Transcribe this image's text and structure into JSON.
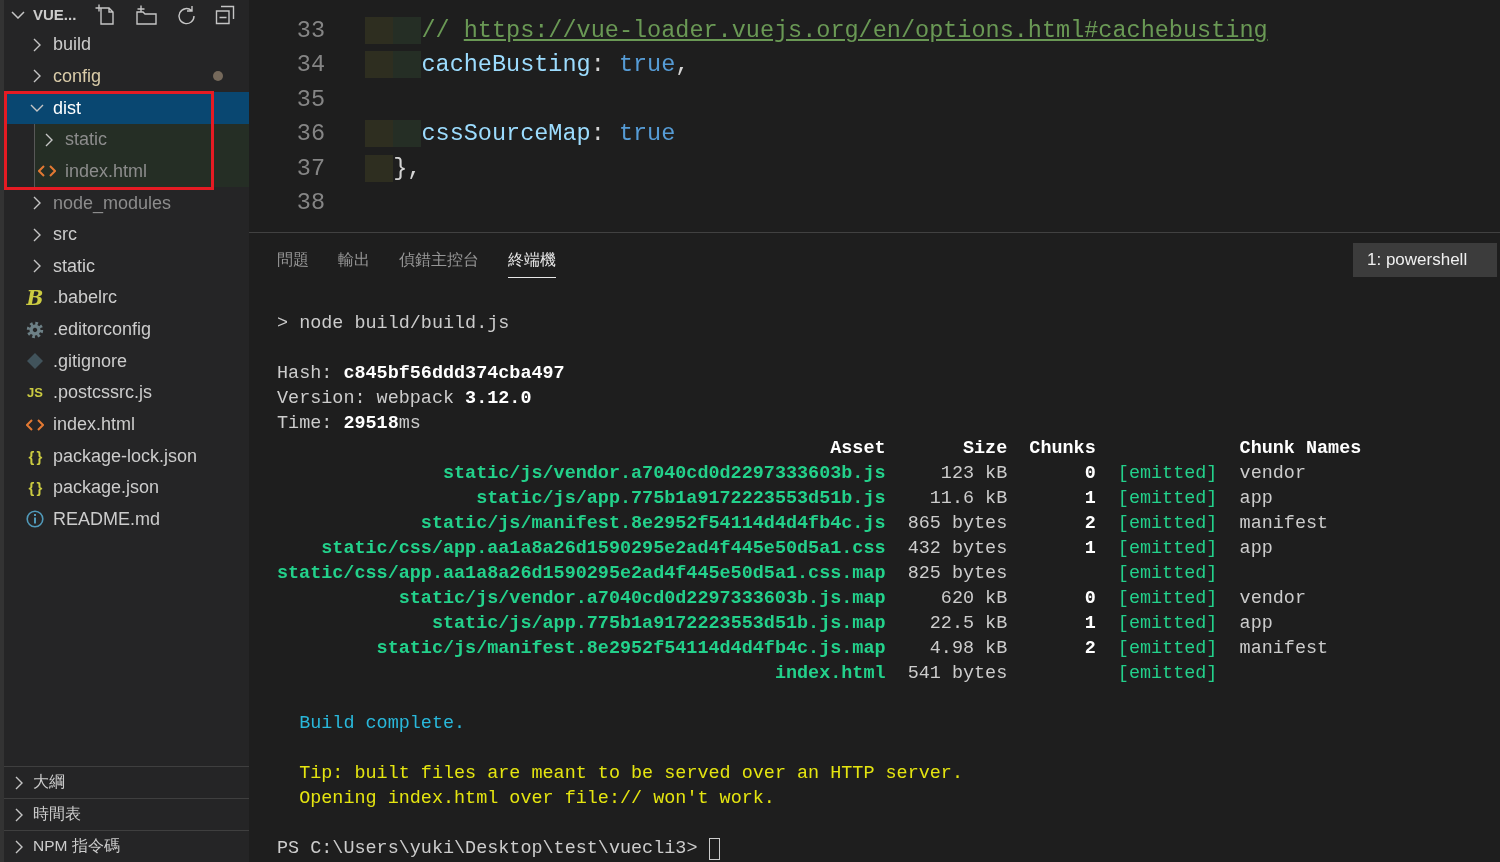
{
  "explorer": {
    "title": "VUE...",
    "tree": [
      {
        "label": "build",
        "kind": "folder",
        "expanded": false,
        "selected": false,
        "dimmed": false,
        "modified": false,
        "highlighted": false
      },
      {
        "label": "config",
        "kind": "folder",
        "expanded": false,
        "selected": false,
        "dimmed": false,
        "modified": true,
        "highlighted": false
      },
      {
        "label": "dist",
        "kind": "folder",
        "expanded": true,
        "selected": true,
        "dimmed": false,
        "modified": false,
        "highlighted": true,
        "children": [
          {
            "label": "static",
            "kind": "folder",
            "expanded": false,
            "selected": false,
            "dimmed": true,
            "modified": false,
            "highlighted": false
          },
          {
            "label": "index.html",
            "kind": "html",
            "selected": false,
            "dimmed": true,
            "modified": false,
            "highlighted": false
          }
        ]
      },
      {
        "label": "node_modules",
        "kind": "folder",
        "expanded": false,
        "selected": false,
        "dimmed": true,
        "modified": false,
        "highlighted": false
      },
      {
        "label": "src",
        "kind": "folder",
        "expanded": false,
        "selected": false,
        "dimmed": false,
        "modified": false,
        "highlighted": false
      },
      {
        "label": "static",
        "kind": "folder",
        "expanded": false,
        "selected": false,
        "dimmed": false,
        "modified": false,
        "highlighted": false
      },
      {
        "label": ".babelrc",
        "kind": "babel",
        "glyph": "B",
        "selected": false,
        "dimmed": false,
        "modified": false,
        "highlighted": false
      },
      {
        "label": ".editorconfig",
        "kind": "config",
        "selected": false,
        "dimmed": false,
        "modified": false,
        "highlighted": false
      },
      {
        "label": ".gitignore",
        "kind": "git",
        "selected": false,
        "dimmed": false,
        "modified": false,
        "highlighted": false
      },
      {
        "label": ".postcssrc.js",
        "kind": "js",
        "glyph": "JS",
        "selected": false,
        "dimmed": false,
        "modified": false,
        "highlighted": false
      },
      {
        "label": "index.html",
        "kind": "html",
        "selected": false,
        "dimmed": false,
        "modified": false,
        "highlighted": false
      },
      {
        "label": "package-lock.json",
        "kind": "json",
        "glyph": "{ }",
        "selected": false,
        "dimmed": false,
        "modified": false,
        "highlighted": false
      },
      {
        "label": "package.json",
        "kind": "json",
        "glyph": "{ }",
        "selected": false,
        "dimmed": false,
        "modified": false,
        "highlighted": false
      },
      {
        "label": "README.md",
        "kind": "info",
        "selected": false,
        "dimmed": false,
        "modified": false,
        "highlighted": false
      }
    ]
  },
  "panes": [
    {
      "label": "大綱",
      "expanded": false
    },
    {
      "label": "時間表",
      "expanded": false
    },
    {
      "label": "NPM 指令碼",
      "expanded": false
    }
  ],
  "editor": {
    "lines": [
      {
        "number": "33",
        "tokens": [
          {
            "kind": "comment",
            "text": "    // "
          },
          {
            "kind": "link",
            "text": "https://vue-loader.vuejs.org/en/options.html#cachebusting"
          }
        ]
      },
      {
        "number": "34",
        "tokens": [
          {
            "kind": "property",
            "text": "    cacheBusting"
          },
          {
            "kind": "punctuation",
            "text": ": "
          },
          {
            "kind": "boolean",
            "text": "true"
          },
          {
            "kind": "punctuation",
            "text": ","
          }
        ]
      },
      {
        "number": "35"
      },
      {
        "number": "36",
        "tokens": [
          {
            "kind": "property",
            "text": "    cssSourceMap"
          },
          {
            "kind": "punctuation",
            "text": ": "
          },
          {
            "kind": "boolean",
            "text": "true"
          }
        ]
      },
      {
        "number": "37",
        "tokens": [
          {
            "kind": "punctuation",
            "text": "  },"
          }
        ]
      },
      {
        "number": "38"
      }
    ]
  },
  "panel": {
    "tabs": [
      {
        "label": "問題",
        "selected": false
      },
      {
        "label": "輸出",
        "selected": false
      },
      {
        "label": "偵錯主控台",
        "selected": false
      },
      {
        "label": "終端機",
        "selected": true
      }
    ],
    "terminal_picker": {
      "value": "1: powershell"
    },
    "terminal": {
      "lines": [
        {
          "kind": "command",
          "text": "> node build/build.js"
        },
        {
          "kind": "blank"
        },
        {
          "kind": "stat",
          "text": "Hash: **c845bf56ddd374cba497**"
        },
        {
          "kind": "stat",
          "text": "Version: webpack **3.12.0**"
        },
        {
          "kind": "stat",
          "text": "Time: **29518**ms"
        },
        {
          "kind": "table",
          "columns": [
            "Asset",
            "Size",
            "Chunks",
            "Chunk Names"
          ],
          "rows": [
            {
              "asset": "static/js/vendor.a7040cd0d2297333603b.js",
              "size": "123 kB",
              "chunks": "0",
              "status": "[emitted]",
              "chunk_names": "vendor"
            },
            {
              "asset": "static/js/app.775b1a9172223553d51b.js",
              "size": "11.6 kB",
              "chunks": "1",
              "status": "[emitted]",
              "chunk_names": "app"
            },
            {
              "asset": "static/js/manifest.8e2952f54114d4d4fb4c.js",
              "size": "865 bytes",
              "chunks": "2",
              "status": "[emitted]",
              "chunk_names": "manifest"
            },
            {
              "asset": "static/css/app.aa1a8a26d1590295e2ad4f445e50d5a1.css",
              "size": "432 bytes",
              "chunks": "1",
              "status": "[emitted]",
              "chunk_names": "app"
            },
            {
              "asset": "static/css/app.aa1a8a26d1590295e2ad4f445e50d5a1.css.map",
              "size": "825 bytes",
              "status": "[emitted]"
            },
            {
              "asset": "static/js/vendor.a7040cd0d2297333603b.js.map",
              "size": "620 kB",
              "chunks": "0",
              "status": "[emitted]",
              "chunk_names": "vendor"
            },
            {
              "asset": "static/js/app.775b1a9172223553d51b.js.map",
              "size": "22.5 kB",
              "chunks": "1",
              "status": "[emitted]",
              "chunk_names": "app"
            },
            {
              "asset": "static/js/manifest.8e2952f54114d4d4fb4c.js.map",
              "size": "4.98 kB",
              "chunks": "2",
              "status": "[emitted]",
              "chunk_names": "manifest"
            },
            {
              "asset": "index.html",
              "size": "541 bytes",
              "status": "[emitted]"
            }
          ]
        },
        {
          "kind": "blank"
        },
        {
          "kind": "success",
          "text": "Build complete."
        },
        {
          "kind": "blank"
        },
        {
          "kind": "warning",
          "text": "Tip: built files are meant to be served over an HTTP server."
        },
        {
          "kind": "warning",
          "text": "Opening index.html over file:// won't work."
        },
        {
          "kind": "blank"
        },
        {
          "kind": "prompt",
          "text": "PS C:\\Users\\yuki\\Desktop\\test\\vuecli3>",
          "cursor": true
        }
      ]
    }
  }
}
